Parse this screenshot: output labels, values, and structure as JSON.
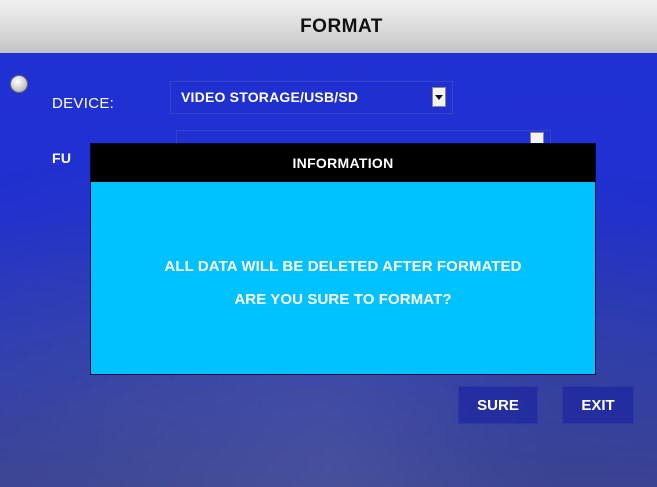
{
  "title": "FORMAT",
  "form": {
    "device_label": "DEVICE:",
    "device_value": "VIDEO STORAGE/USB/SD",
    "function_label_partial": "FU"
  },
  "dialog": {
    "title": "INFORMATION",
    "message_line1": "ALL DATA WILL BE DELETED AFTER FORMATED",
    "message_line2": "ARE YOU SURE TO FORMAT?"
  },
  "buttons": {
    "sure": "SURE",
    "exit": "EXIT"
  },
  "colors": {
    "background_blue": "#1f2fd0",
    "dialog_cyan": "#00c2ff",
    "dialog_header": "#000000",
    "title_bar": "#d8d8d8",
    "text": "#ffffff"
  },
  "icons": {
    "radio": "radio-button-icon",
    "dropdown": "chevron-down-icon"
  }
}
